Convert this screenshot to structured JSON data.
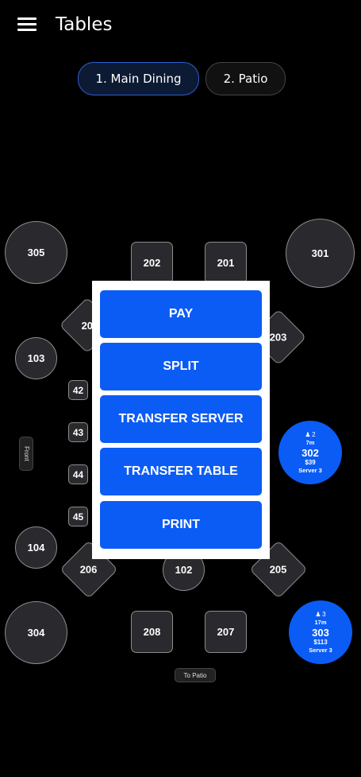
{
  "header": {
    "title": "Tables",
    "menu_icon": "hamburger-menu-icon"
  },
  "rooms": [
    {
      "label": "1. Main Dining",
      "active": true
    },
    {
      "label": "2. Patio",
      "active": false
    }
  ],
  "tables": {
    "t305": "305",
    "t301": "301",
    "t202": "202",
    "t201": "201",
    "t20x": "20",
    "t203": "203",
    "t103": "103",
    "t42": "42",
    "t43": "43",
    "t44": "44",
    "t45": "45",
    "t104": "104",
    "t206": "206",
    "t102": "102",
    "t205": "205",
    "t304": "304",
    "t208": "208",
    "t207": "207",
    "t302": {
      "guests": "2",
      "time": "7m",
      "number": "302",
      "amount": "$39",
      "server": "Server 3"
    },
    "t303": {
      "guests": "3",
      "time": "17m",
      "number": "303",
      "amount": "$113",
      "server": "Server 3"
    }
  },
  "labels": {
    "front": "Front",
    "to_patio": "To Patio"
  },
  "action_menu": {
    "pay": "PAY",
    "split": "SPLIT",
    "transfer_server": "TRANSFER SERVER",
    "transfer_table": "TRANSFER TABLE",
    "print": "PRINT"
  },
  "colors": {
    "accent": "#0b5cf5",
    "background": "#000000",
    "table_fill": "#2a2a2e"
  }
}
